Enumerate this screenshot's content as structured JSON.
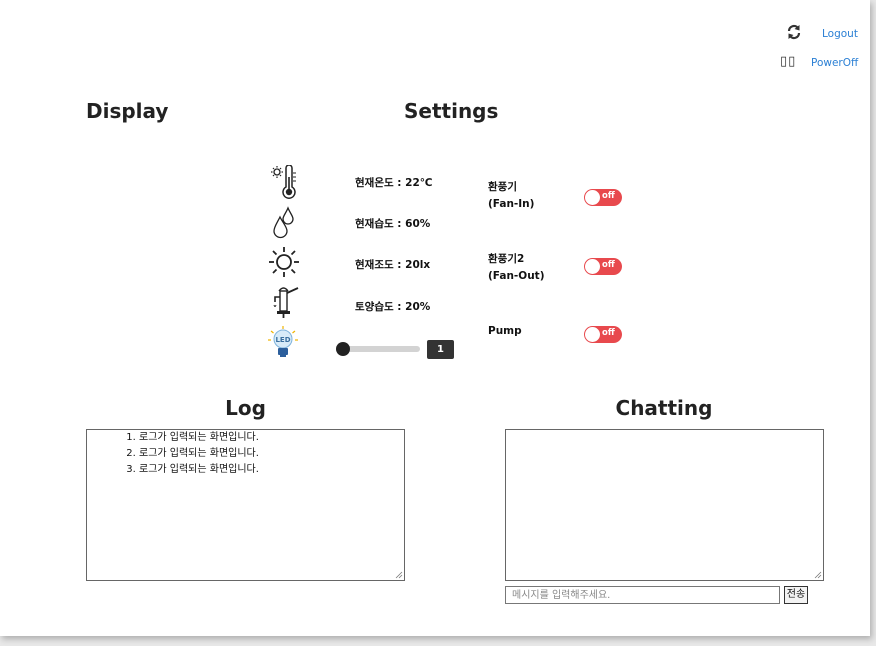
{
  "header": {
    "refresh_icon": "refresh-icon",
    "logout_label": "Logout",
    "power_icon_text": "▯▯",
    "poweroff_label": "PowerOff"
  },
  "sections": {
    "display_title": "Display",
    "settings_title": "Settings",
    "log_title": "Log",
    "chatting_title": "Chatting"
  },
  "display": {
    "readings": [
      {
        "icon": "thermometer-icon",
        "label": "현재온도 : 22℃"
      },
      {
        "icon": "water-drops-icon",
        "label": "현재습도 : 60%"
      },
      {
        "icon": "sun-icon",
        "label": "현재조도 : 20lx"
      },
      {
        "icon": "water-pump-icon",
        "label": "토양습도 : 20%"
      }
    ],
    "led": {
      "icon": "led-bulb-icon",
      "icon_text": "LED",
      "slider_value": 1,
      "slider_min": 1,
      "slider_max": 10,
      "value_text": "1"
    }
  },
  "settings": {
    "items": [
      {
        "line1": "환풍기",
        "line2": "(Fan-In)",
        "toggle": "off"
      },
      {
        "line1": "환풍기2",
        "line2": "(Fan-Out)",
        "toggle": "off"
      },
      {
        "line1": "Pump",
        "line2": "",
        "toggle": "off"
      }
    ]
  },
  "log": {
    "entries": [
      "로그가 입력되는 화면입니다.",
      "로그가 입력되는 화면입니다.",
      "로그가 입력되는 화면입니다."
    ]
  },
  "chat": {
    "placeholder": "메시지를 입력해주세요.",
    "send_label": "전송"
  },
  "colors": {
    "toggle_off": "#e8494d",
    "link": "#2a7fd4",
    "slider_thumb": "#222222"
  }
}
